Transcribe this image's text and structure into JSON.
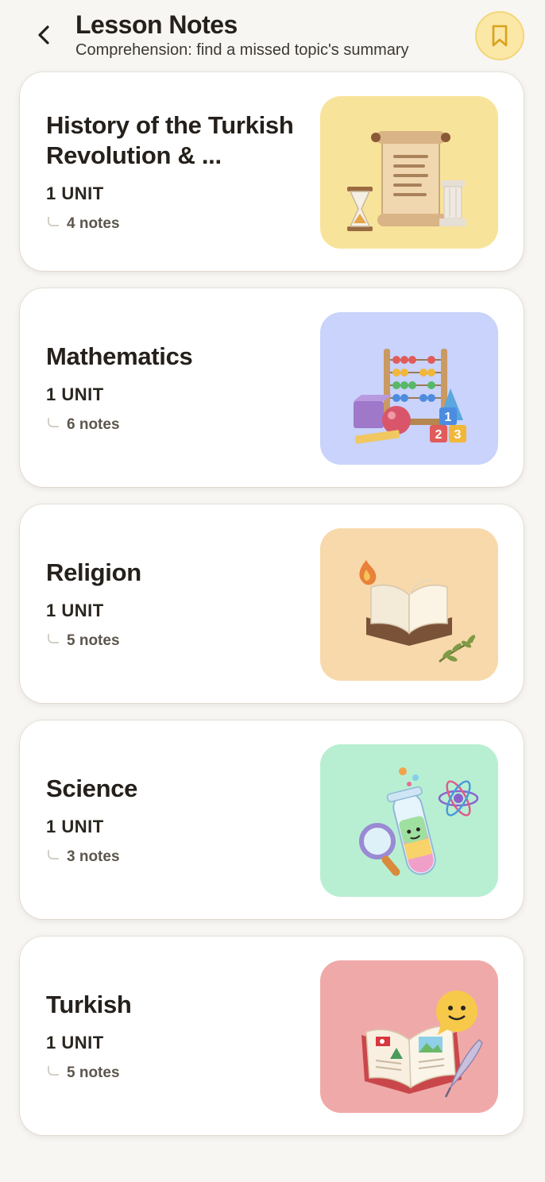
{
  "header": {
    "title": "Lesson Notes",
    "subtitle": "Comprehension: find a missed topic's summary",
    "back_icon": "chevron-left-icon",
    "bookmark_icon": "bookmark-icon",
    "bookmark_bg": "#fbe7a6",
    "bookmark_color": "#d9a21a"
  },
  "lessons": [
    {
      "title": "History of the Turkish Revolution & ...",
      "units": "1 UNIT",
      "notes": "4 notes",
      "illustration": "scroll-hourglass-column-icon",
      "bg": "#f8e39a"
    },
    {
      "title": "Mathematics",
      "units": "1 UNIT",
      "notes": "6 notes",
      "illustration": "abacus-shapes-icon",
      "bg": "#c9d3fb"
    },
    {
      "title": "Religion",
      "units": "1 UNIT",
      "notes": "5 notes",
      "illustration": "open-book-flame-icon",
      "bg": "#f8d9ab"
    },
    {
      "title": "Science",
      "units": "1 UNIT",
      "notes": "3 notes",
      "illustration": "test-tube-atom-icon",
      "bg": "#b8efd3"
    },
    {
      "title": "Turkish",
      "units": "1 UNIT",
      "notes": "5 notes",
      "illustration": "storybook-quill-icon",
      "bg": "#f0a9a9"
    }
  ]
}
